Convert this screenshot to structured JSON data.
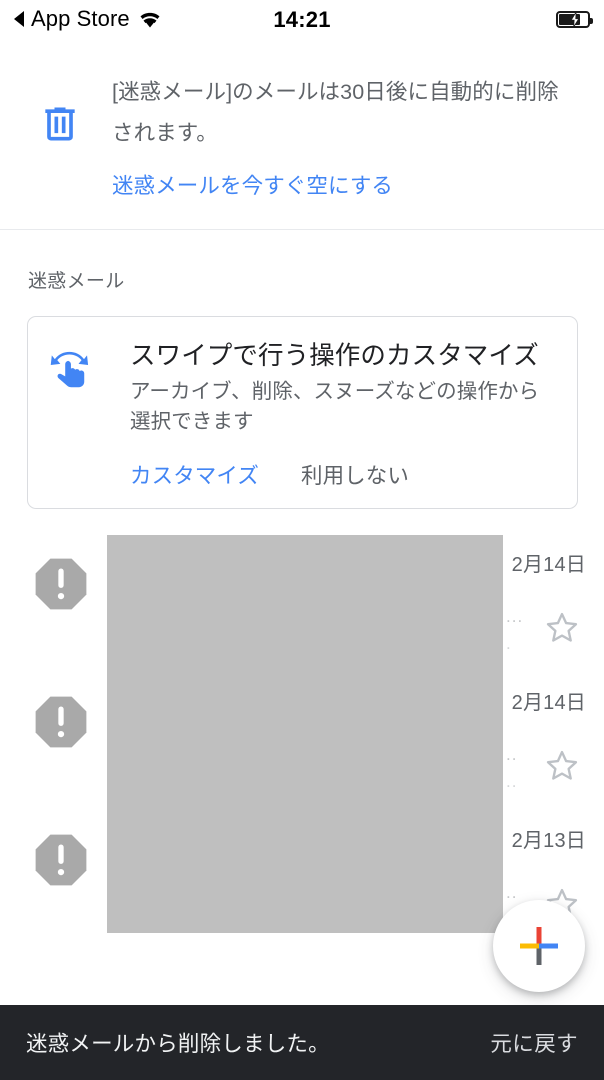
{
  "status_bar": {
    "back_label": "App Store",
    "back_icon": "triangle-left-icon",
    "wifi_icon": "wifi-icon",
    "time": "14:21",
    "battery_icon": "battery-charging-icon"
  },
  "banner": {
    "icon": "trash-can-icon",
    "text": "[迷惑メール]のメールは30日後に自動的に削除されます。",
    "link_label": "迷惑メールを今すぐ空にする",
    "link_color": "#4285f4"
  },
  "section": {
    "label": "迷惑メール"
  },
  "promo_card": {
    "icon": "swipe-gesture-icon",
    "title": "スワイプで行う操作のカスタマイズ",
    "description": "アーカイブ、削除、スヌーズなどの操作から選択できます",
    "primary_label": "カスタマイズ",
    "secondary_label": "利用しない",
    "primary_color": "#4285f4",
    "secondary_color": "#5f6368"
  },
  "mail_list": {
    "avatar_icon": "spam-octagon-exclamation-icon",
    "star_icon": "star-outline-icon",
    "overflow_glyph": "…",
    "rows": [
      {
        "date": "2月14日",
        "dots": "...",
        "dots2": "."
      },
      {
        "date": "2月14日",
        "dots": "..",
        "dots2": ".."
      },
      {
        "date": "2月13日",
        "dots": "..",
        "dots2": ""
      }
    ]
  },
  "fab": {
    "icon": "compose-plus-icon",
    "colors": {
      "top": "#ea4335",
      "left": "#fbbc04",
      "right": "#4285f4",
      "bottom": "#5f6368"
    }
  },
  "snackbar": {
    "message": "迷惑メールから削除しました。",
    "action_label": "元に戻す",
    "background": "#232529"
  }
}
